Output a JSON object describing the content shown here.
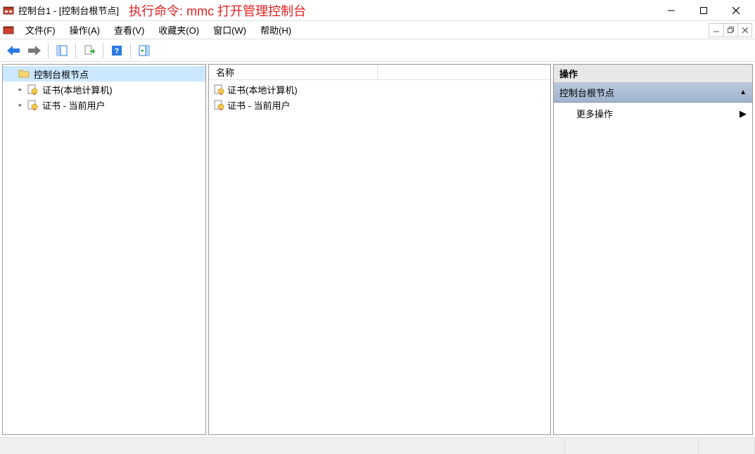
{
  "title_bar": {
    "app_title": "控制台1 - [控制台根节点]",
    "annotation_prefix": "执行命令: ",
    "annotation_cmd": "mmc",
    "annotation_suffix": "  打开管理控制台"
  },
  "menu": {
    "file": "文件(F)",
    "action": "操作(A)",
    "view": "查看(V)",
    "favorites": "收藏夹(O)",
    "window": "窗口(W)",
    "help": "帮助(H)"
  },
  "tree": {
    "root": "控制台根节点",
    "items": [
      {
        "label": "证书(本地计算机)"
      },
      {
        "label": "证书 - 当前用户"
      }
    ]
  },
  "list": {
    "column_header": "名称",
    "rows": [
      {
        "label": "证书(本地计算机)"
      },
      {
        "label": "证书 - 当前用户"
      }
    ]
  },
  "actions": {
    "header": "操作",
    "section_title": "控制台根节点",
    "more_actions": "更多操作"
  }
}
